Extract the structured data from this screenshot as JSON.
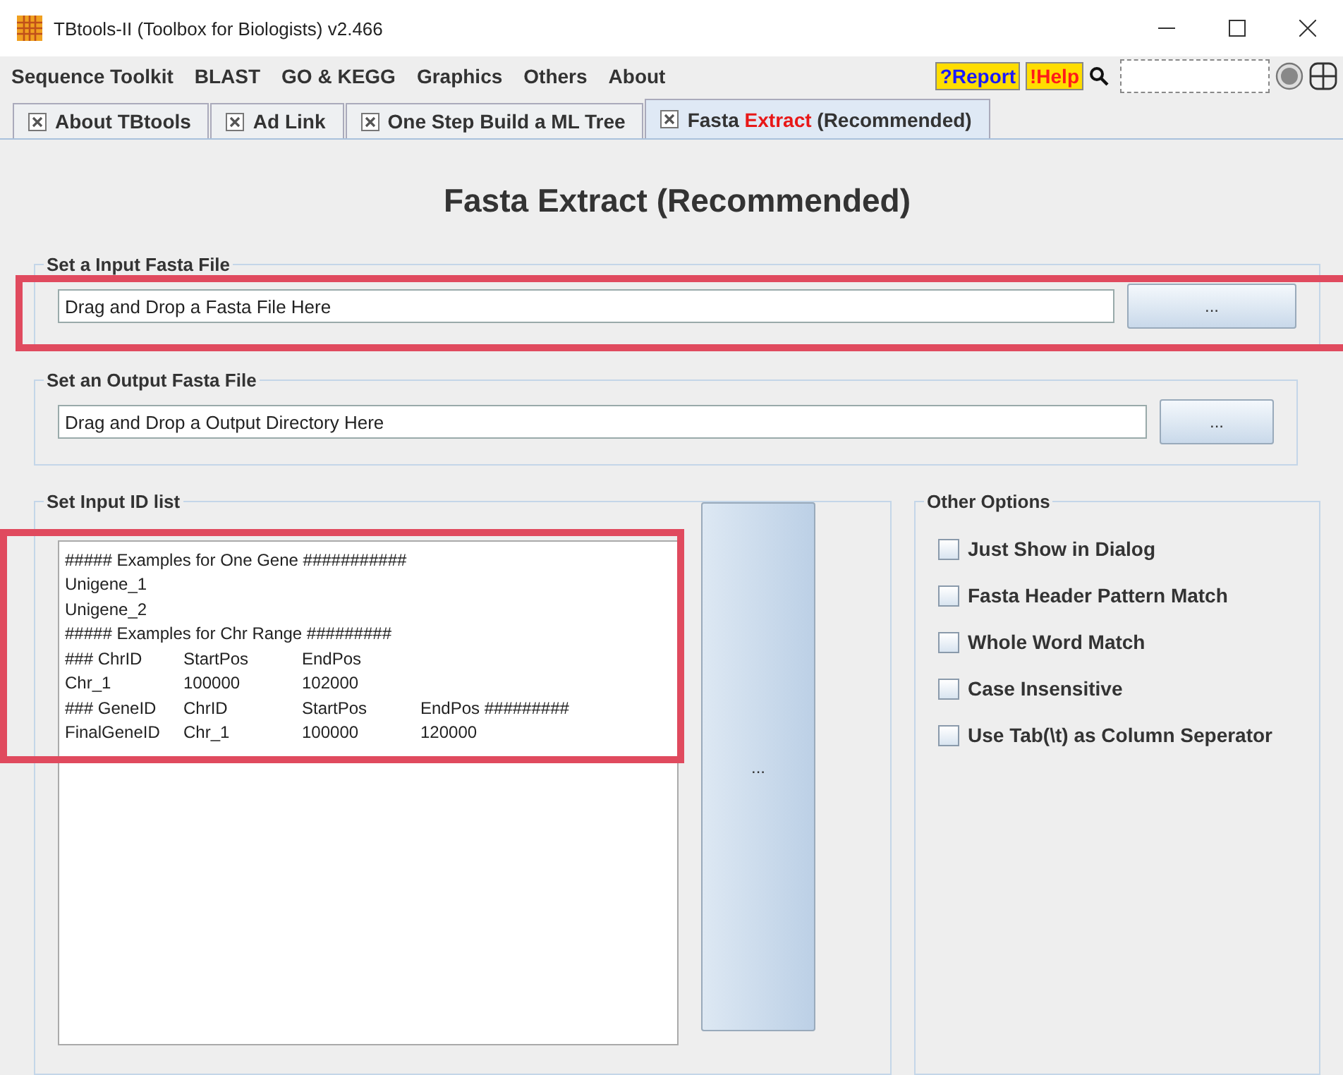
{
  "window": {
    "title": "TBtools-II (Toolbox for Biologists) v2.466"
  },
  "menu": [
    "Sequence Toolkit",
    "BLAST",
    "GO & KEGG",
    "Graphics",
    "Others",
    "About"
  ],
  "toolbar": {
    "report": "?Report",
    "help": "!Help"
  },
  "tabs": [
    {
      "parts": [
        {
          "text": "About TBtools",
          "accent": false
        }
      ],
      "selected": false
    },
    {
      "parts": [
        {
          "text": "Ad Link",
          "accent": false
        }
      ],
      "selected": false
    },
    {
      "parts": [
        {
          "text": "One Step Build a ML Tree",
          "accent": false
        }
      ],
      "selected": false
    },
    {
      "parts": [
        {
          "text": "Fasta ",
          "accent": false
        },
        {
          "text": "Extract",
          "accent": true
        },
        {
          "text": " (Recommended)",
          "accent": false
        }
      ],
      "selected": true
    }
  ],
  "heading": "Fasta Extract (Recommended)",
  "input_file": {
    "legend": "Set a Input Fasta File",
    "placeholder": "Drag and Drop a Fasta File Here",
    "button": "...",
    "highlighted": true
  },
  "output_file": {
    "legend": "Set an Output Fasta File",
    "placeholder": "Drag and Drop a Output Directory Here",
    "button": "...",
    "highlighted": false
  },
  "id_list": {
    "legend": "Set Input ID list",
    "button": "...",
    "highlighted": true,
    "lines": [
      [
        "##### Examples for One Gene ###########"
      ],
      [
        "Unigene_1"
      ],
      [
        "Unigene_2"
      ],
      [
        "##### Examples for Chr Range #########"
      ],
      [
        "### ChrID",
        "StartPos",
        "EndPos"
      ],
      [
        "Chr_1",
        "100000",
        "102000"
      ],
      [
        "### GeneID",
        "ChrID",
        "StartPos",
        "EndPos #########"
      ],
      [
        "FinalGeneID",
        "Chr_1",
        "100000",
        "120000"
      ]
    ]
  },
  "other_options": {
    "legend": "Other Options",
    "items": [
      {
        "label": "Just Show in Dialog",
        "checked": false
      },
      {
        "label": "Fasta Header Pattern Match",
        "checked": false
      },
      {
        "label": "Whole Word Match",
        "checked": false
      },
      {
        "label": "Case Insensitive",
        "checked": false
      },
      {
        "label": "Use Tab(\\t) as Column Seperator",
        "checked": false
      }
    ]
  }
}
